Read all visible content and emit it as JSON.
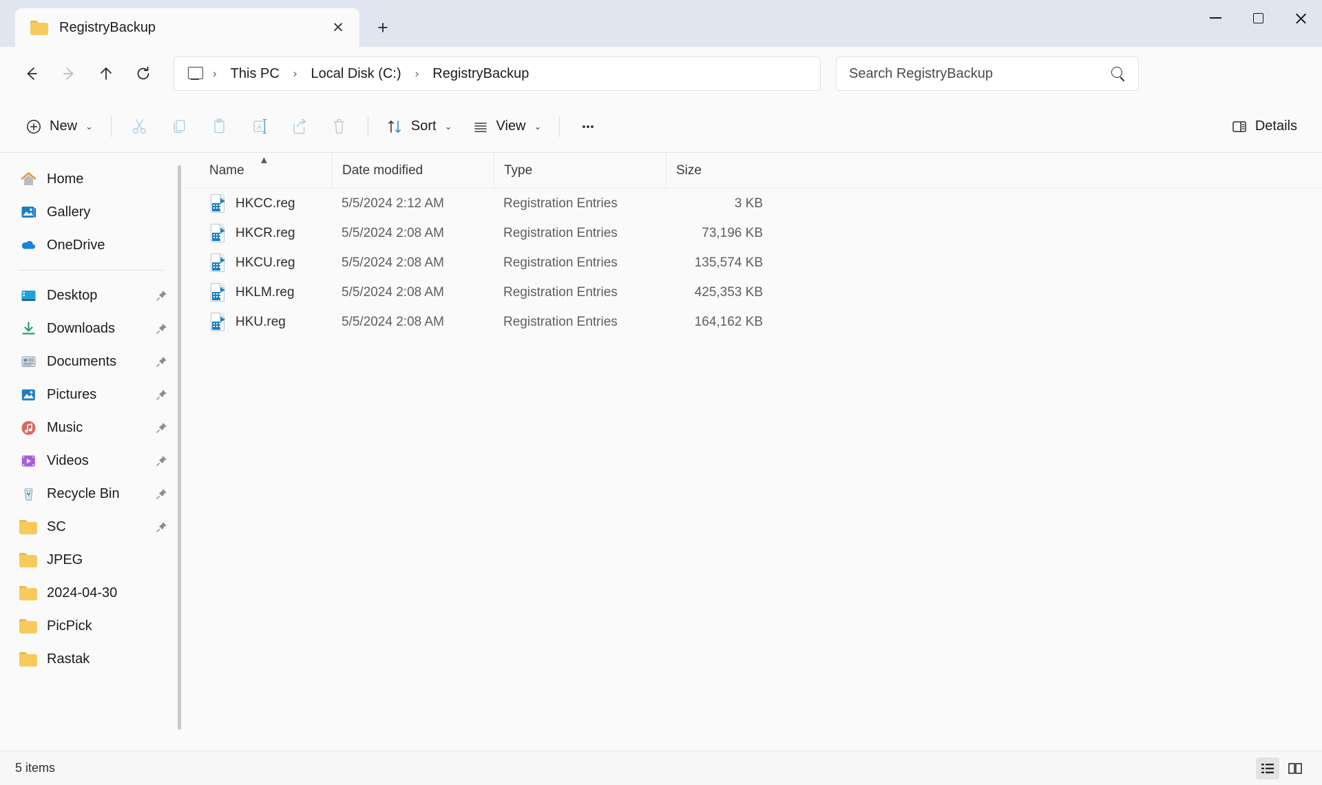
{
  "window": {
    "tab_title": "RegistryBackup",
    "tab_close_glyph": "✕",
    "new_tab_glyph": "+",
    "minimize_label": "Minimize",
    "maximize_label": "Maximize",
    "close_label": "Close"
  },
  "address": {
    "back_label": "Back",
    "forward_label": "Forward",
    "up_label": "Up",
    "refresh_label": "Refresh",
    "breadcrumbs": [
      "This PC",
      "Local Disk (C:)",
      "RegistryBackup"
    ],
    "separator": "›",
    "search_placeholder": "Search RegistryBackup"
  },
  "toolbar": {
    "new_label": "New",
    "cut_label": "Cut",
    "copy_label": "Copy",
    "paste_label": "Paste",
    "rename_label": "Rename",
    "share_label": "Share",
    "delete_label": "Delete",
    "sort_label": "Sort",
    "view_label": "View",
    "more_label": "…",
    "details_label": "Details",
    "chevron": "⌄"
  },
  "sidebar": {
    "quick": [
      {
        "label": "Home",
        "icon": "home-icon",
        "pinned": false
      },
      {
        "label": "Gallery",
        "icon": "gallery-icon",
        "pinned": false
      },
      {
        "label": "OneDrive",
        "icon": "onedrive-icon",
        "pinned": false
      }
    ],
    "pinned": [
      {
        "label": "Desktop",
        "icon": "desktop-icon",
        "pinned": true
      },
      {
        "label": "Downloads",
        "icon": "downloads-icon",
        "pinned": true
      },
      {
        "label": "Documents",
        "icon": "documents-icon",
        "pinned": true
      },
      {
        "label": "Pictures",
        "icon": "pictures-icon",
        "pinned": true
      },
      {
        "label": "Music",
        "icon": "music-icon",
        "pinned": true
      },
      {
        "label": "Videos",
        "icon": "videos-icon",
        "pinned": true
      },
      {
        "label": "Recycle Bin",
        "icon": "recycle-bin-icon",
        "pinned": true
      },
      {
        "label": "SC",
        "icon": "folder-icon",
        "pinned": true
      },
      {
        "label": "JPEG",
        "icon": "folder-icon",
        "pinned": false
      },
      {
        "label": "2024-04-30",
        "icon": "folder-icon",
        "pinned": false
      },
      {
        "label": "PicPick",
        "icon": "folder-icon",
        "pinned": false
      },
      {
        "label": "Rastak",
        "icon": "folder-icon",
        "pinned": false
      }
    ]
  },
  "filelist": {
    "columns": [
      "Name",
      "Date modified",
      "Type",
      "Size"
    ],
    "sort_column": "Name",
    "sort_direction": "ascending",
    "rows": [
      {
        "name": "HKCC.reg",
        "date": "5/5/2024 2:12 AM",
        "type": "Registration Entries",
        "size": "3 KB"
      },
      {
        "name": "HKCR.reg",
        "date": "5/5/2024 2:08 AM",
        "type": "Registration Entries",
        "size": "73,196 KB"
      },
      {
        "name": "HKCU.reg",
        "date": "5/5/2024 2:08 AM",
        "type": "Registration Entries",
        "size": "135,574 KB"
      },
      {
        "name": "HKLM.reg",
        "date": "5/5/2024 2:08 AM",
        "type": "Registration Entries",
        "size": "425,353 KB"
      },
      {
        "name": "HKU.reg",
        "date": "5/5/2024 2:08 AM",
        "type": "Registration Entries",
        "size": "164,162 KB"
      }
    ]
  },
  "status": {
    "item_count": "5 items",
    "details_view_label": "Details view",
    "large_icons_view_label": "Large icons view"
  }
}
